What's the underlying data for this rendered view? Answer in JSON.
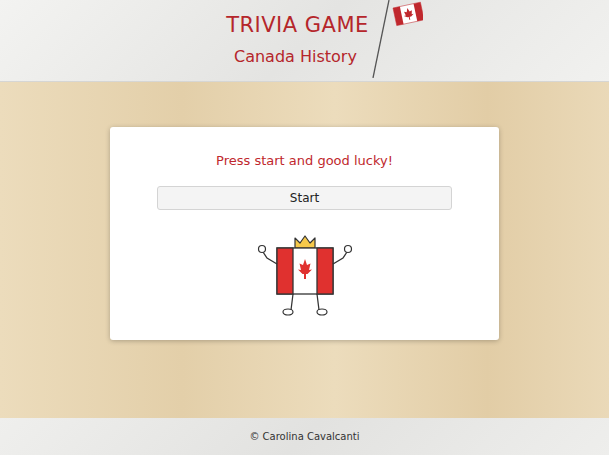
{
  "header": {
    "title": "TRIVIA GAME",
    "subtitle": "Canada History"
  },
  "card": {
    "message": "Press start and good lucky!",
    "button": "Start"
  },
  "footer": {
    "text": "© Carolina Cavalcanti"
  }
}
